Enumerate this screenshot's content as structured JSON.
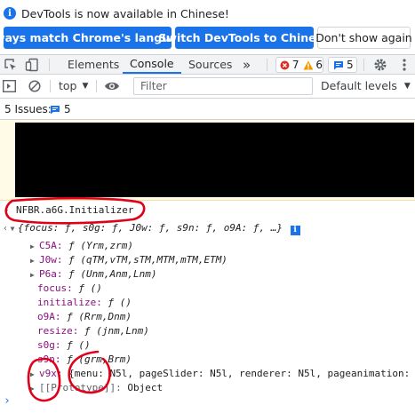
{
  "infobar": {
    "message": "DevTools is now available in Chinese!",
    "buttons": {
      "match_language": "Always match Chrome's language",
      "switch_language": "Switch DevTools to Chinese",
      "dismiss": "Don't show again"
    }
  },
  "tabs": {
    "items": [
      "Elements",
      "Console",
      "Sources"
    ],
    "active": "Console",
    "more_glyph": "»",
    "errors_count": "7",
    "warnings_count": "6",
    "messages_count": "5"
  },
  "console_toolbar": {
    "context": "top",
    "filter_placeholder": "Filter",
    "levels": "Default levels"
  },
  "issues": {
    "label": "5 Issues:",
    "count": "5"
  },
  "console": {
    "input_command": "NFBR.a6G.Initializer",
    "object_summary": "{focus: ƒ, s0g: ƒ, J0w: ƒ, s9n: ƒ, o9A: ƒ, …}",
    "info_glyph": "i",
    "properties": [
      {
        "key": "C5A:",
        "value": "ƒ (Yrm,zrm)",
        "expandable": true
      },
      {
        "key": "J0w:",
        "value": "ƒ (qTM,vTM,sTM,MTM,mTM,ETM)",
        "expandable": true
      },
      {
        "key": "P6a:",
        "value": "ƒ (Unm,Anm,Lnm)",
        "expandable": true
      },
      {
        "key": "focus:",
        "value": "ƒ ()",
        "expandable": false
      },
      {
        "key": "initialize:",
        "value": "ƒ ()",
        "expandable": false
      },
      {
        "key": "o9A:",
        "value": "ƒ (Rrm,Dnm)",
        "expandable": false
      },
      {
        "key": "resize:",
        "value": "ƒ (jnm,Lnm)",
        "expandable": false
      },
      {
        "key": "s0g:",
        "value": "ƒ ()",
        "expandable": false
      },
      {
        "key": "s9n:",
        "value": "ƒ (grm,Brm)",
        "expandable": false
      },
      {
        "key": "v9x:",
        "value": "{menu: N5l, pageSlider: N5l, renderer: N5l, pageanimation:",
        "expandable": true
      },
      {
        "key": "[[Prototype]]:",
        "value": "Object",
        "expandable": true
      }
    ],
    "prompt_glyph": "›"
  },
  "colors": {
    "accent": "#1a73e8",
    "error": "#d93025",
    "warning": "#f29900",
    "property_key": "#881280",
    "annotation": "#e0001a"
  }
}
